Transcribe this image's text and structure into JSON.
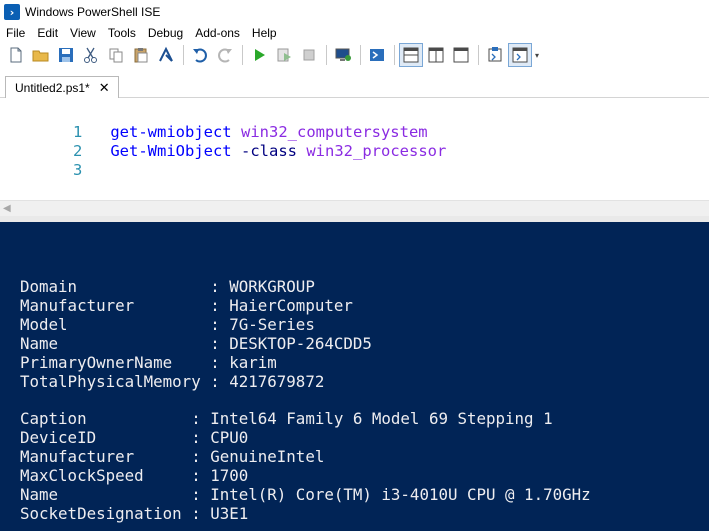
{
  "window": {
    "title": "Windows PowerShell ISE"
  },
  "menu": [
    "File",
    "Edit",
    "View",
    "Tools",
    "Debug",
    "Add-ons",
    "Help"
  ],
  "toolbar": {
    "buttons": [
      "new-file-icon",
      "open-folder-icon",
      "save-icon",
      "cut-icon",
      "copy-icon",
      "paste-icon",
      "clear-console-icon",
      "undo-icon",
      "redo-icon",
      "run-icon",
      "run-selection-icon",
      "stop-icon",
      "remote-powershell-icon",
      "powershell-icon",
      "script-pane-top-icon",
      "script-pane-right-icon",
      "script-pane-max-icon",
      "commands-addon-icon",
      "show-script-pane-icon"
    ]
  },
  "tab": {
    "label": "Untitled2.ps1*",
    "close": "✕"
  },
  "editor": {
    "lines": [
      {
        "num": "1",
        "cmd": "get-wmiobject",
        "param": "",
        "arg": "win32_computersystem"
      },
      {
        "num": "2",
        "cmd": "Get-WmiObject",
        "param": "-class",
        "arg": "win32_processor"
      },
      {
        "num": "3",
        "cmd": "",
        "param": "",
        "arg": ""
      }
    ]
  },
  "console": {
    "computersystem": [
      "Domain              : WORKGROUP",
      "Manufacturer        : HaierComputer",
      "Model               : 7G-Series",
      "Name                : DESKTOP-264CDD5",
      "PrimaryOwnerName    : karim",
      "TotalPhysicalMemory : 4217679872"
    ],
    "processor": [
      "Caption           : Intel64 Family 6 Model 69 Stepping 1",
      "DeviceID          : CPU0",
      "Manufacturer      : GenuineIntel",
      "MaxClockSpeed     : 1700",
      "Name              : Intel(R) Core(TM) i3-4010U CPU @ 1.70GHz",
      "SocketDesignation : U3E1"
    ]
  },
  "colors": {
    "console_bg": "#012456",
    "console_fg": "#eeedf0",
    "cmdlet": "#0000ff",
    "argument": "#8a2be2",
    "line_number": "#2b91af"
  }
}
